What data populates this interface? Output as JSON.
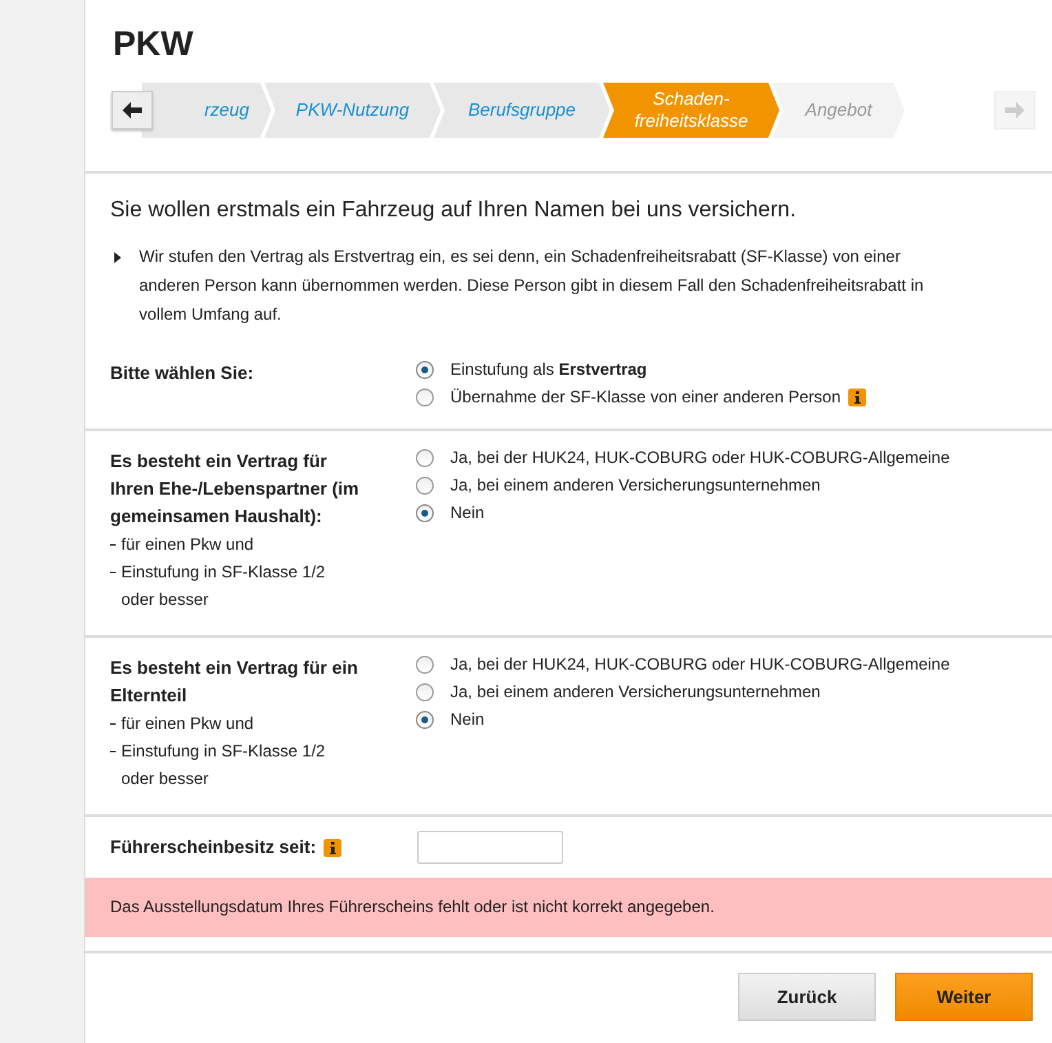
{
  "title": "PKW",
  "steps": [
    {
      "label": "rzeug",
      "selected": false,
      "disabled": false
    },
    {
      "label": "PKW-Nutzung",
      "selected": false,
      "disabled": false
    },
    {
      "label": "Berufsgruppe",
      "selected": false,
      "disabled": false
    },
    {
      "label": "Schaden-\nfreiheitsklasse",
      "selected": true,
      "disabled": false
    },
    {
      "label": "Angebot",
      "selected": false,
      "disabled": true
    }
  ],
  "nav": {
    "back_disabled": false,
    "forward_disabled": true
  },
  "heading": "Sie wollen erstmals ein Fahrzeug auf Ihren Namen bei uns versichern.",
  "bullet": "Wir stufen den Vertrag als Erstvertrag ein, es sei denn, ein Schadenfreiheitsrabatt (SF-Klasse) von einer anderen Person kann übernommen werden. Diese Person gibt in diesem Fall den Schadenfreiheitsrabatt in vollem Umfang auf.",
  "questions": [
    {
      "title": "Bitte wählen Sie:",
      "options": [
        {
          "label": "Einstufung als **Erstvertrag**",
          "selected": true,
          "info": false
        },
        {
          "label": "Übernahme der SF-Klasse von einer anderen Person",
          "selected": false,
          "info": true
        }
      ]
    },
    {
      "title": "Es besteht ein Vertrag für Ihren Ehe-/Lebenspartner (im gemeinsamen Haushalt):",
      "notes": [
        "für einen Pkw und",
        "Einstufung in SF-Klasse 1/2 oder besser"
      ],
      "options": [
        {
          "label": "Ja, bei der HUK24, HUK-COBURG oder HUK-COBURG-Allgemeine",
          "selected": false,
          "info": false
        },
        {
          "label": "Ja, bei einem anderen Versicherungsunternehmen",
          "selected": false,
          "info": false
        },
        {
          "label": "Nein",
          "selected": true,
          "info": false
        }
      ]
    },
    {
      "title": "Es besteht ein Vertrag für ein Elternteil",
      "notes": [
        "für einen Pkw und",
        "Einstufung in SF-Klasse 1/2 oder besser"
      ],
      "options": [
        {
          "label": "Ja, bei der HUK24, HUK-COBURG oder HUK-COBURG-Allgemeine",
          "selected": false,
          "info": false
        },
        {
          "label": "Ja, bei einem anderen Versicherungsunternehmen",
          "selected": false,
          "info": false
        },
        {
          "label": "Nein",
          "selected": true,
          "info": false
        }
      ]
    }
  ],
  "license": {
    "label": "Führerscheinbesitz seit:",
    "info": true
  },
  "error": "Das Ausstellungsdatum Ihres Führerscheins fehlt oder ist nicht korrekt angegeben.",
  "buttons": [
    {
      "label": "Zurück",
      "kind": "secondary"
    },
    {
      "label": "Weiter",
      "kind": "primary"
    }
  ]
}
